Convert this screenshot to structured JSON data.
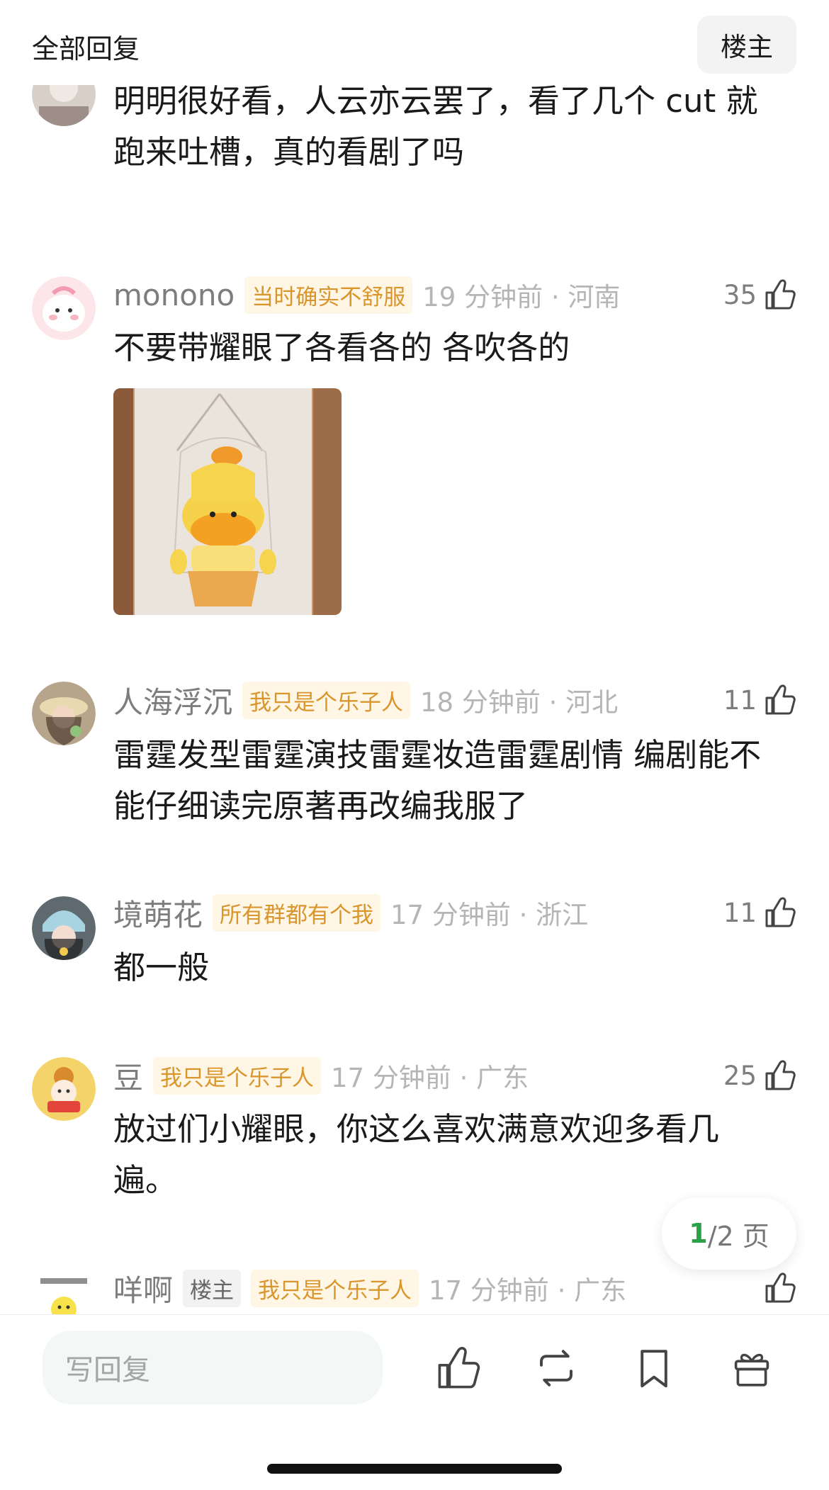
{
  "header": {
    "title": "全部回复",
    "owner_button": "楼主"
  },
  "comments": [
    {
      "username": "",
      "badge": "",
      "time": "",
      "likes": "",
      "text": "明明很好看，人云亦云罢了，看了几个 cut 就跑来吐槽，真的看剧了吗"
    },
    {
      "username": "monono",
      "badge": "当时确实不舒服",
      "time": "19 分钟前 · 河南",
      "likes": "35",
      "text": "不要带耀眼了各看各的 各吹各的"
    },
    {
      "username": "人海浮沉",
      "badge": "我只是个乐子人",
      "time": "18 分钟前 · 河北",
      "likes": "11",
      "text": "雷霆发型雷霆演技雷霆妆造雷霆剧情   编剧能不能仔细读完原著再改编我服了"
    },
    {
      "username": "境萌花",
      "badge": "所有群都有个我",
      "time": "17 分钟前 · 浙江",
      "likes": "11",
      "text": "都一般"
    },
    {
      "username": "豆",
      "badge": "我只是个乐子人",
      "time": "17 分钟前 · 广东",
      "likes": "25",
      "text": "放过们小耀眼，你这么喜欢满意欢迎多看几遍。"
    },
    {
      "username": "咩啊",
      "owner_tag": "楼主",
      "badge": "我只是个乐子人",
      "time": "17 分钟前 · 广东",
      "likes": "",
      "text": ""
    }
  ],
  "pager": {
    "current": "1",
    "rest": "/2 页"
  },
  "bottom": {
    "reply_placeholder": "写回复"
  },
  "colors": {
    "accent_green": "#2aa24a",
    "badge_text": "#d8962d",
    "badge_bg": "#fff6e6"
  }
}
